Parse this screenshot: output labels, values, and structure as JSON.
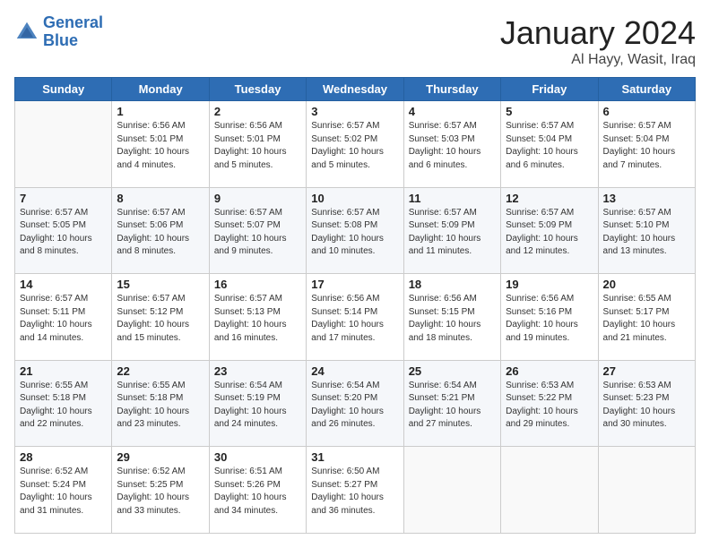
{
  "logo": {
    "line1": "General",
    "line2": "Blue"
  },
  "header": {
    "month": "January 2024",
    "location": "Al Hayy, Wasit, Iraq"
  },
  "weekdays": [
    "Sunday",
    "Monday",
    "Tuesday",
    "Wednesday",
    "Thursday",
    "Friday",
    "Saturday"
  ],
  "weeks": [
    [
      {
        "day": "",
        "info": ""
      },
      {
        "day": "1",
        "info": "Sunrise: 6:56 AM\nSunset: 5:01 PM\nDaylight: 10 hours\nand 4 minutes."
      },
      {
        "day": "2",
        "info": "Sunrise: 6:56 AM\nSunset: 5:01 PM\nDaylight: 10 hours\nand 5 minutes."
      },
      {
        "day": "3",
        "info": "Sunrise: 6:57 AM\nSunset: 5:02 PM\nDaylight: 10 hours\nand 5 minutes."
      },
      {
        "day": "4",
        "info": "Sunrise: 6:57 AM\nSunset: 5:03 PM\nDaylight: 10 hours\nand 6 minutes."
      },
      {
        "day": "5",
        "info": "Sunrise: 6:57 AM\nSunset: 5:04 PM\nDaylight: 10 hours\nand 6 minutes."
      },
      {
        "day": "6",
        "info": "Sunrise: 6:57 AM\nSunset: 5:04 PM\nDaylight: 10 hours\nand 7 minutes."
      }
    ],
    [
      {
        "day": "7",
        "info": "Sunrise: 6:57 AM\nSunset: 5:05 PM\nDaylight: 10 hours\nand 8 minutes."
      },
      {
        "day": "8",
        "info": "Sunrise: 6:57 AM\nSunset: 5:06 PM\nDaylight: 10 hours\nand 8 minutes."
      },
      {
        "day": "9",
        "info": "Sunrise: 6:57 AM\nSunset: 5:07 PM\nDaylight: 10 hours\nand 9 minutes."
      },
      {
        "day": "10",
        "info": "Sunrise: 6:57 AM\nSunset: 5:08 PM\nDaylight: 10 hours\nand 10 minutes."
      },
      {
        "day": "11",
        "info": "Sunrise: 6:57 AM\nSunset: 5:09 PM\nDaylight: 10 hours\nand 11 minutes."
      },
      {
        "day": "12",
        "info": "Sunrise: 6:57 AM\nSunset: 5:09 PM\nDaylight: 10 hours\nand 12 minutes."
      },
      {
        "day": "13",
        "info": "Sunrise: 6:57 AM\nSunset: 5:10 PM\nDaylight: 10 hours\nand 13 minutes."
      }
    ],
    [
      {
        "day": "14",
        "info": "Sunrise: 6:57 AM\nSunset: 5:11 PM\nDaylight: 10 hours\nand 14 minutes."
      },
      {
        "day": "15",
        "info": "Sunrise: 6:57 AM\nSunset: 5:12 PM\nDaylight: 10 hours\nand 15 minutes."
      },
      {
        "day": "16",
        "info": "Sunrise: 6:57 AM\nSunset: 5:13 PM\nDaylight: 10 hours\nand 16 minutes."
      },
      {
        "day": "17",
        "info": "Sunrise: 6:56 AM\nSunset: 5:14 PM\nDaylight: 10 hours\nand 17 minutes."
      },
      {
        "day": "18",
        "info": "Sunrise: 6:56 AM\nSunset: 5:15 PM\nDaylight: 10 hours\nand 18 minutes."
      },
      {
        "day": "19",
        "info": "Sunrise: 6:56 AM\nSunset: 5:16 PM\nDaylight: 10 hours\nand 19 minutes."
      },
      {
        "day": "20",
        "info": "Sunrise: 6:55 AM\nSunset: 5:17 PM\nDaylight: 10 hours\nand 21 minutes."
      }
    ],
    [
      {
        "day": "21",
        "info": "Sunrise: 6:55 AM\nSunset: 5:18 PM\nDaylight: 10 hours\nand 22 minutes."
      },
      {
        "day": "22",
        "info": "Sunrise: 6:55 AM\nSunset: 5:18 PM\nDaylight: 10 hours\nand 23 minutes."
      },
      {
        "day": "23",
        "info": "Sunrise: 6:54 AM\nSunset: 5:19 PM\nDaylight: 10 hours\nand 24 minutes."
      },
      {
        "day": "24",
        "info": "Sunrise: 6:54 AM\nSunset: 5:20 PM\nDaylight: 10 hours\nand 26 minutes."
      },
      {
        "day": "25",
        "info": "Sunrise: 6:54 AM\nSunset: 5:21 PM\nDaylight: 10 hours\nand 27 minutes."
      },
      {
        "day": "26",
        "info": "Sunrise: 6:53 AM\nSunset: 5:22 PM\nDaylight: 10 hours\nand 29 minutes."
      },
      {
        "day": "27",
        "info": "Sunrise: 6:53 AM\nSunset: 5:23 PM\nDaylight: 10 hours\nand 30 minutes."
      }
    ],
    [
      {
        "day": "28",
        "info": "Sunrise: 6:52 AM\nSunset: 5:24 PM\nDaylight: 10 hours\nand 31 minutes."
      },
      {
        "day": "29",
        "info": "Sunrise: 6:52 AM\nSunset: 5:25 PM\nDaylight: 10 hours\nand 33 minutes."
      },
      {
        "day": "30",
        "info": "Sunrise: 6:51 AM\nSunset: 5:26 PM\nDaylight: 10 hours\nand 34 minutes."
      },
      {
        "day": "31",
        "info": "Sunrise: 6:50 AM\nSunset: 5:27 PM\nDaylight: 10 hours\nand 36 minutes."
      },
      {
        "day": "",
        "info": ""
      },
      {
        "day": "",
        "info": ""
      },
      {
        "day": "",
        "info": ""
      }
    ]
  ]
}
